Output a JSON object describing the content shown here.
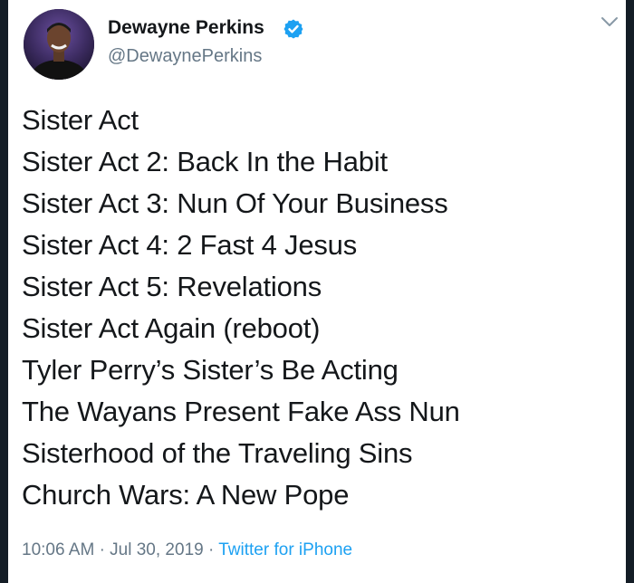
{
  "tweet": {
    "author": {
      "display_name": "Dewayne Perkins",
      "handle": "@DewaynePerkins",
      "verified": true,
      "avatar_icon": "profile-photo"
    },
    "menu_icon": "chevron-down-icon",
    "lines": [
      "Sister Act",
      "Sister Act 2: Back In the Habit",
      "Sister Act 3: Nun Of Your Business",
      "Sister Act 4: 2 Fast 4 Jesus",
      "Sister Act 5: Revelations",
      "Sister Act Again (reboot)",
      "Tyler Perry’s Sister’s Be Acting",
      "The Wayans Present Fake Ass Nun",
      "Sisterhood of the Traveling Sins",
      "Church Wars: A New Pope"
    ],
    "time": "10:06 AM",
    "date": "Jul 30, 2019",
    "separator": "·",
    "source": "Twitter for iPhone"
  },
  "colors": {
    "text": "#14171a",
    "secondary": "#657786",
    "link": "#1da1f2",
    "verified": "#1da1f2",
    "background": "#ffffff",
    "frame": "#141d26"
  }
}
